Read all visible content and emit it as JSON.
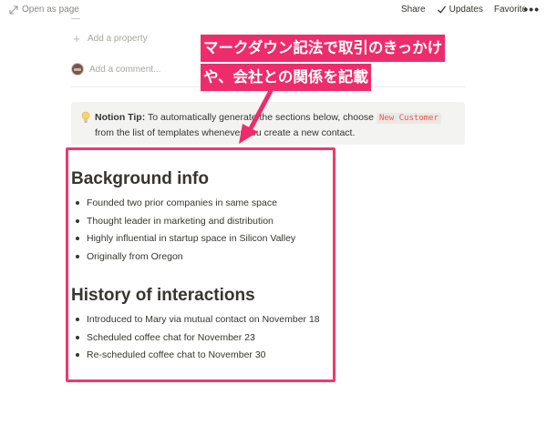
{
  "topbar": {
    "open_as_page": "Open as page",
    "share": "Share",
    "updates": "Updates",
    "favorite": "Favorite",
    "more": "•••"
  },
  "properties": {
    "add_property": "Add a property"
  },
  "comment": {
    "placeholder": "Add a comment..."
  },
  "callout": {
    "icon": "lightbulb-icon",
    "tip_label": "Notion Tip:",
    "text_before": " To automatically generate the sections below, choose ",
    "code": "New Customer",
    "text_after": " from the list of templates whenever you create a new contact."
  },
  "sections": {
    "background": {
      "heading": "Background info",
      "items": [
        "Founded two prior companies in same space",
        "Thought leader in marketing and distribution",
        "Highly influential in startup space in Silicon Valley",
        "Originally from Oregon"
      ]
    },
    "history": {
      "heading": "History of interactions",
      "items": [
        "Introduced to Mary via mutual contact on November 18",
        "Scheduled coffee chat for November 23",
        "Re-scheduled coffee chat to November 30"
      ]
    }
  },
  "annotation": {
    "line1": "マークダウン記法で取引のきっかけ",
    "line2": "や、会社との関係を記載",
    "color": "#ee2c6b",
    "box_color": "#f2376d"
  }
}
